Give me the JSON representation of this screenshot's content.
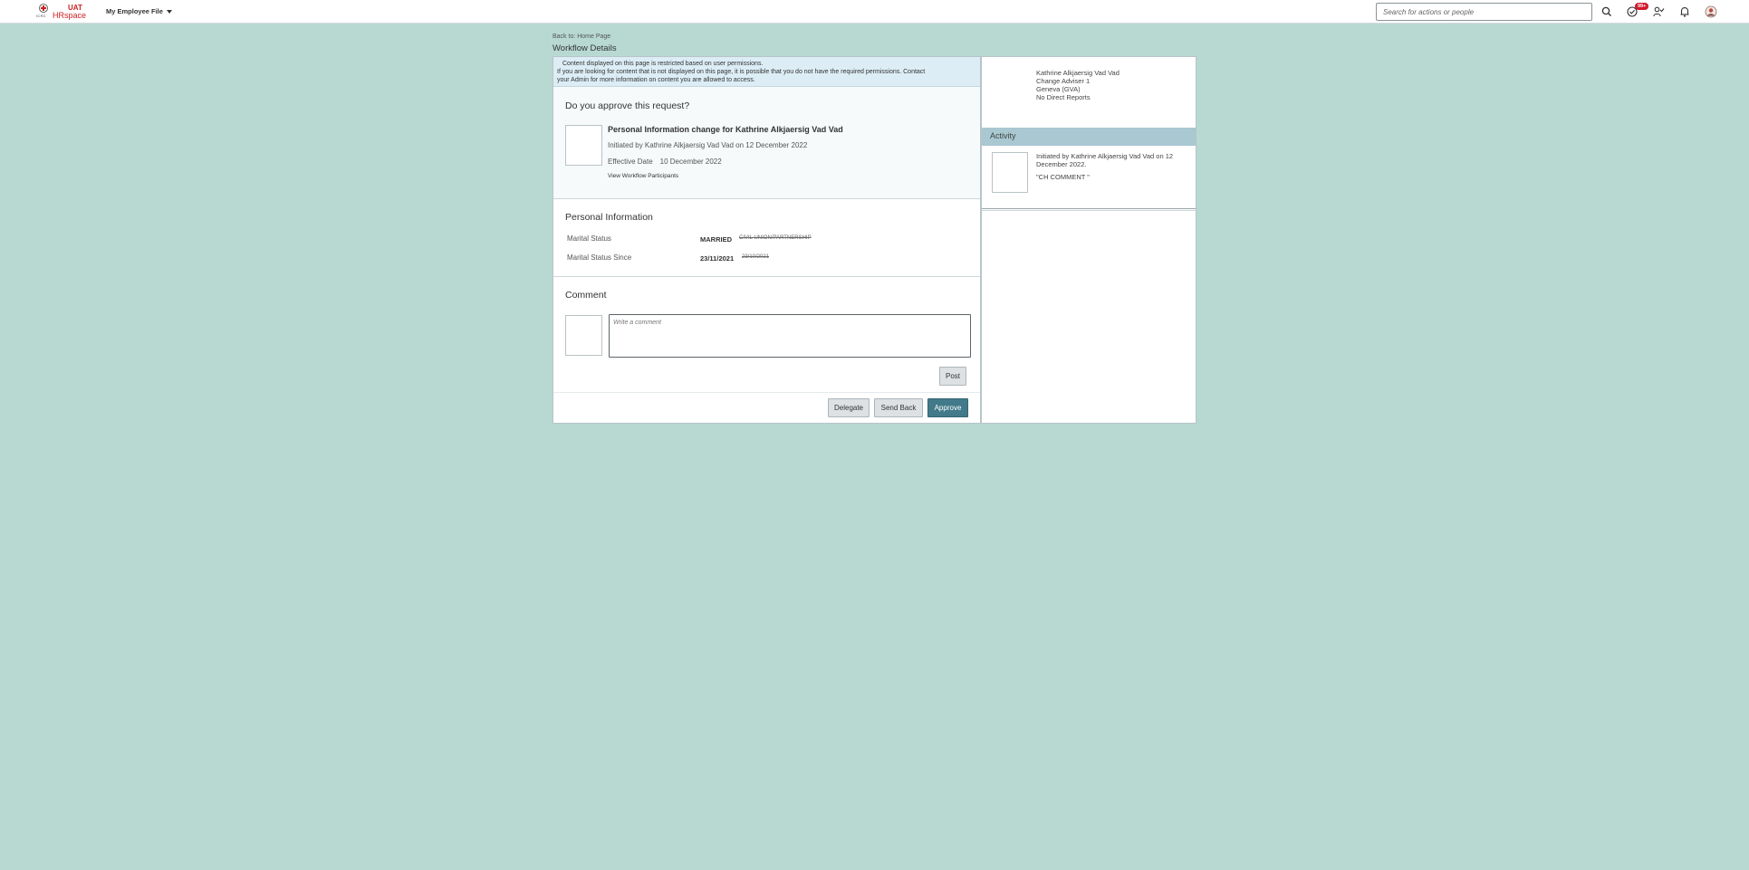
{
  "header": {
    "logo": {
      "org": "ICRC",
      "env": "UAT",
      "app": "HRspace"
    },
    "nav_menu": "My Employee File",
    "search_placeholder": "Search for actions or people",
    "todo_badge": "99+"
  },
  "page": {
    "back_link": "Back to: Home Page",
    "title": "Workflow Details"
  },
  "notice": {
    "line1": "Content displayed on this page is restricted based on user permissions.",
    "line2": "If you are looking for content that is not displayed on this page, it is possible that you do not have the required permissions. Contact",
    "line3": "your Admin for more information on content you are allowed to access."
  },
  "approval": {
    "question": "Do you approve this request?",
    "request_title": "Personal Information change for Kathrine Alkjaersig Vad Vad",
    "initiated": "Initiated by Kathrine Alkjaersig Vad Vad on 12 December 2022",
    "effective_label": "Effective Date",
    "effective_value": "10 December 2022",
    "participants_link": "View Workflow Participants"
  },
  "personal_info": {
    "heading": "Personal Information",
    "rows": [
      {
        "label": "Marital Status",
        "new_value": "MARRIED",
        "old_value": "CIVIL UNION/PARTNERSHIP"
      },
      {
        "label": "Marital Status Since",
        "new_value": "23/11/2021",
        "old_value": "23/10/2021"
      }
    ]
  },
  "comment": {
    "heading": "Comment",
    "placeholder": "Write a comment",
    "post_label": "Post"
  },
  "actions": {
    "delegate": "Delegate",
    "send_back": "Send Back",
    "approve": "Approve"
  },
  "profile": {
    "name": "Kathrine Alkjaersig Vad Vad",
    "position": "Change Adviser 1",
    "location": "Geneva (GVA)",
    "reports": "No Direct Reports"
  },
  "activity": {
    "heading": "Activity",
    "text_line1": "Initiated by Kathrine Alkjaersig Vad Vad on 12",
    "text_line2": "December 2022.",
    "comment": "\"CH COMMENT \""
  },
  "colors": {
    "page_bg": "#b7d9d2",
    "brand_red": "#cc1f1f",
    "approve_button": "#427a8a",
    "activity_bar": "#a9c8d2",
    "notice_bg": "#dcedf5"
  }
}
